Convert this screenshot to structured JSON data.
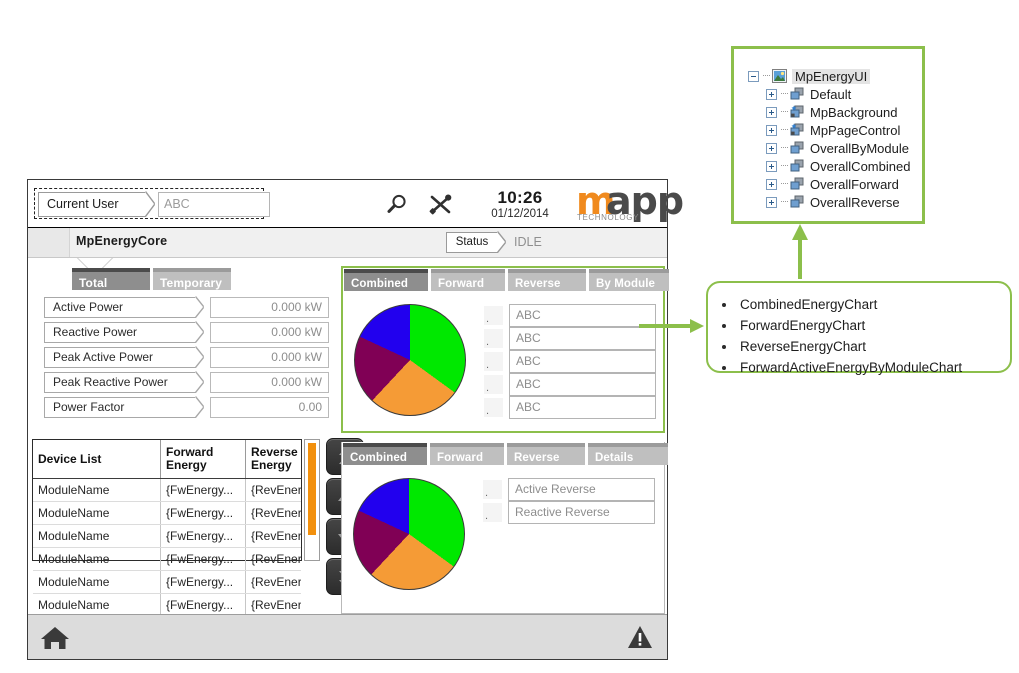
{
  "hmi": {
    "header": {
      "user_label": "Current User",
      "user_value": "ABC",
      "time": "10:26",
      "date": "01/12/2014",
      "logo_m": "m",
      "logo_app": "app",
      "logo_tech": "TECHNOLOGY",
      "search_icon": "search-icon",
      "tools_icon": "tools-icon"
    },
    "titlebar": {
      "title": "MpEnergyCore",
      "status_label": "Status",
      "status_value": "IDLE"
    },
    "left_tabs": [
      {
        "label": "Total",
        "selected": true
      },
      {
        "label": "Temporary",
        "selected": false
      }
    ],
    "metrics": [
      {
        "label": "Active Power",
        "value": "0.000 kW"
      },
      {
        "label": "Reactive Power",
        "value": "0.000 kW"
      },
      {
        "label": "Peak Active Power",
        "value": "0.000 kW"
      },
      {
        "label": "Peak Reactive Power",
        "value": "0.000 kW"
      },
      {
        "label": "Power Factor",
        "value": "0.00"
      }
    ],
    "device_table": {
      "columns": [
        "Device List",
        "Forward Energy",
        "Reverse Energy"
      ],
      "rows": [
        [
          "ModuleName",
          "{FwEnergy...",
          "{RevEnerg..."
        ],
        [
          "ModuleName",
          "{FwEnergy...",
          "{RevEnerg..."
        ],
        [
          "ModuleName",
          "{FwEnergy...",
          "{RevEnerg..."
        ],
        [
          "ModuleName",
          "{FwEnergy...",
          "{RevEnerg..."
        ],
        [
          "ModuleName",
          "{FwEnergy...",
          "{RevEnerg..."
        ],
        [
          "ModuleName",
          "{FwEnergy...",
          "{RevEnerg..."
        ]
      ],
      "nav_buttons": [
        "first-page-button",
        "page-up-button",
        "page-down-button",
        "last-page-button"
      ],
      "scrollbar_color": "#f2900d"
    },
    "panel_top": {
      "tabs": [
        {
          "label": "Combined",
          "selected": true
        },
        {
          "label": "Forward",
          "selected": false
        },
        {
          "label": "Reverse",
          "selected": false
        },
        {
          "label": "By Module",
          "selected": false
        }
      ],
      "legend": [
        "ABC",
        "ABC",
        "ABC",
        "ABC",
        "ABC"
      ]
    },
    "panel_bottom": {
      "tabs": [
        {
          "label": "Combined",
          "selected": true
        },
        {
          "label": "Forward",
          "selected": false
        },
        {
          "label": "Reverse",
          "selected": false
        },
        {
          "label": "Details",
          "selected": false
        }
      ],
      "legend": [
        "Active Reverse",
        "Reactive Reverse"
      ]
    },
    "footer": {
      "home_icon": "home-icon",
      "alarm_icon": "warning-triangle-icon"
    }
  },
  "tree": {
    "root": {
      "label": "MpEnergyUI",
      "icon": "image-page-icon",
      "expander": "minus"
    },
    "children": [
      {
        "label": "Default",
        "icon": "pages-icon",
        "expander": "plus"
      },
      {
        "label": "MpBackground",
        "icon": "pages-star-icon",
        "expander": "plus"
      },
      {
        "label": "MpPageControl",
        "icon": "pages-star-icon",
        "expander": "plus"
      },
      {
        "label": "OverallByModule",
        "icon": "pages-icon",
        "expander": "plus"
      },
      {
        "label": "OverallCombined",
        "icon": "pages-icon",
        "expander": "plus"
      },
      {
        "label": "OverallForward",
        "icon": "pages-icon",
        "expander": "plus"
      },
      {
        "label": "OverallReverse",
        "icon": "pages-icon",
        "expander": "plus"
      }
    ]
  },
  "callout": {
    "items": [
      "CombinedEnergyChart",
      "ForwardEnergyChart",
      "ReverseEnergyChart",
      "ForwardActiveEnergyByModuleChart"
    ]
  },
  "colors": {
    "accent_green": "#8cbf4b",
    "brand_orange": "#f08a1e",
    "scroll_orange": "#f2900d",
    "slice_green": "#00e800",
    "slice_orange": "#f59b36",
    "slice_purple": "#800055",
    "slice_blue": "#2200ee"
  },
  "chart_data": [
    {
      "type": "pie",
      "title": "Combined",
      "labels": [
        "ABC",
        "ABC",
        "ABC",
        "ABC"
      ],
      "values": [
        35,
        27,
        20,
        18
      ],
      "colors": [
        "#00e800",
        "#f59b36",
        "#800055",
        "#2200ee"
      ],
      "legend": "right",
      "start_angle_deg": 0
    },
    {
      "type": "pie",
      "title": "Combined",
      "labels": [
        "Active Reverse",
        "Reactive Reverse"
      ],
      "values": [
        35,
        27,
        20,
        18
      ],
      "colors": [
        "#00e800",
        "#f59b36",
        "#800055",
        "#2200ee"
      ],
      "legend": "right",
      "start_angle_deg": 0
    }
  ]
}
